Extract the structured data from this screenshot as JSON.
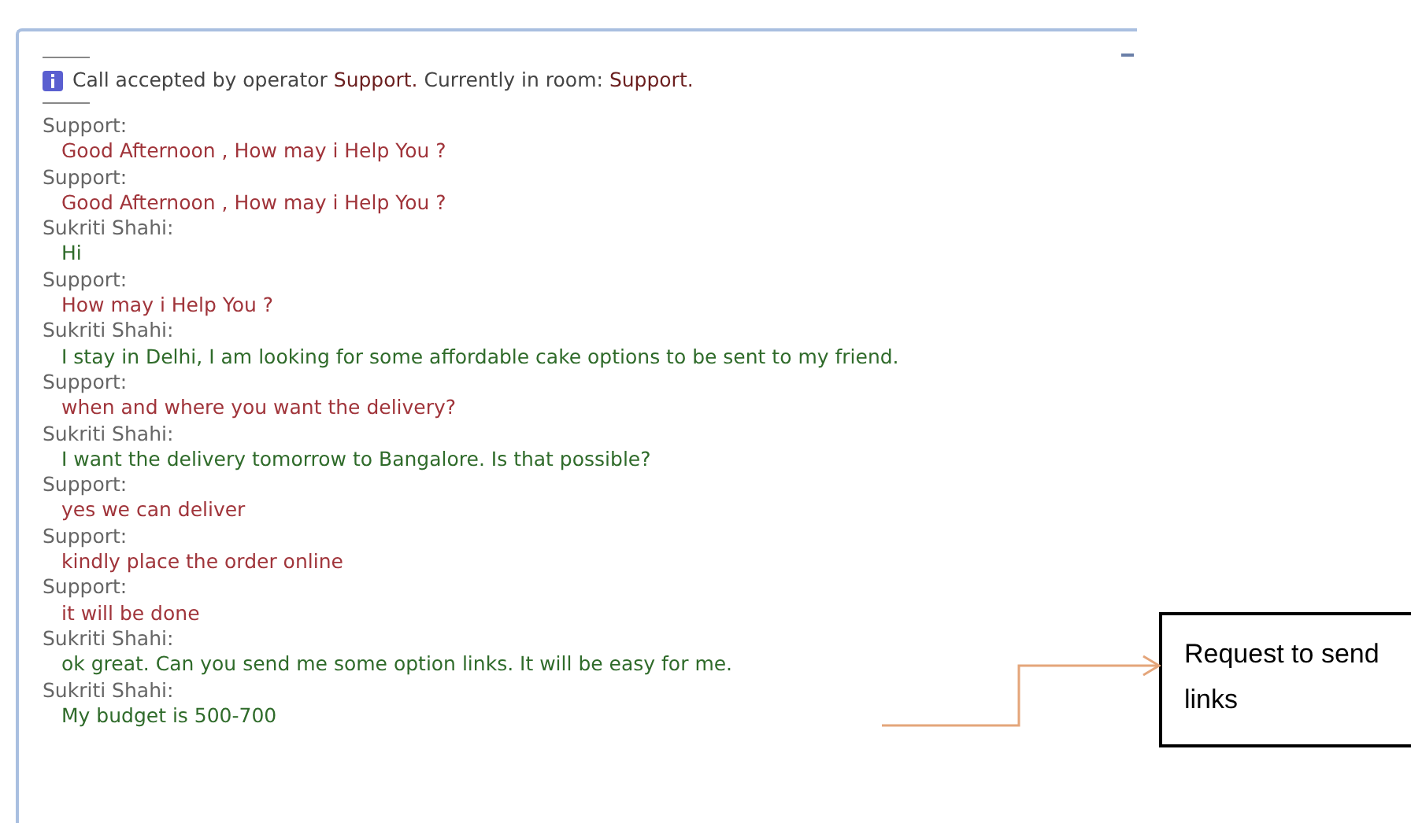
{
  "notice": [
    {
      "kind": "plain",
      "text": "Call accepted by operator "
    },
    {
      "kind": "name",
      "text": "Support."
    },
    {
      "kind": "plain",
      "text": " Currently in room: "
    },
    {
      "kind": "name",
      "text": "Support."
    }
  ],
  "messages": [
    {
      "sender": "Support:",
      "kind": "operator",
      "text": "Good Afternoon , How may i Help You ?"
    },
    {
      "sender": "Support:",
      "kind": "operator",
      "text": "Good Afternoon , How may i Help You ?"
    },
    {
      "sender": "Sukriti Shahi:",
      "kind": "visitor",
      "text": "Hi"
    },
    {
      "sender": "Support:",
      "kind": "operator",
      "text": "How may i Help You ?"
    },
    {
      "sender": "Sukriti Shahi:",
      "kind": "visitor",
      "text": "I stay in Delhi, I am looking for some affordable cake options to be sent to my friend."
    },
    {
      "sender": "Support:",
      "kind": "operator",
      "text": "when and where you want the delivery?"
    },
    {
      "sender": "Sukriti Shahi:",
      "kind": "visitor",
      "text": "I want the delivery tomorrow to Bangalore. Is that possible?"
    },
    {
      "sender": "Support:",
      "kind": "operator",
      "text": "yes we can deliver"
    },
    {
      "sender": "Support:",
      "kind": "operator",
      "text": "kindly place the order online"
    },
    {
      "sender": "Support:",
      "kind": "operator",
      "text": "it will be done"
    },
    {
      "sender": "Sukriti Shahi:",
      "kind": "visitor",
      "text": "ok great. Can you send me some option links. It will be easy for me."
    },
    {
      "sender": "Sukriti Shahi:",
      "kind": "visitor",
      "text": "My budget is 500-700"
    }
  ],
  "callout": {
    "text": "Request to send links"
  }
}
